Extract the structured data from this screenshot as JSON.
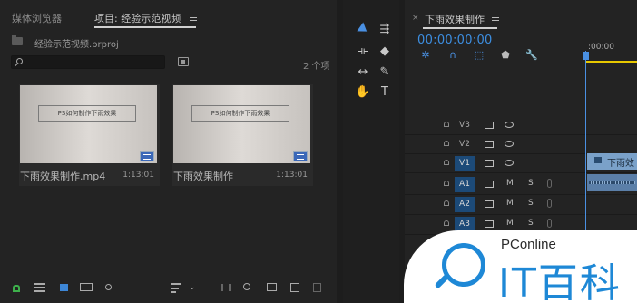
{
  "project_panel": {
    "tab_media_browser": "媒体浏览器",
    "tab_project": "项目: 经验示范视频",
    "project_file": "经验示范视频.prproj",
    "item_count": "2 个项",
    "clips": [
      {
        "thumb_text": "PS如何制作下雨效果",
        "name": "下雨效果制作.mp4",
        "duration": "1:13:01"
      },
      {
        "thumb_text": "PS如何制作下雨效果",
        "name": "下雨效果制作",
        "duration": "1:13:01"
      }
    ]
  },
  "tools": {
    "items": [
      "selection-tool",
      "track-select-tool",
      "ripple-edit-tool",
      "razor-tool",
      "slip-tool",
      "pen-tool",
      "hand-tool",
      "type-tool"
    ],
    "type_glyph": "T"
  },
  "sequence": {
    "title": "下雨效果制作",
    "close_glyph": "×",
    "timecode": "00:00:00:00",
    "ruler_label": ":00:00",
    "tracks": [
      {
        "name": "V3",
        "kind": "video",
        "active": false
      },
      {
        "name": "V2",
        "kind": "video",
        "active": false
      },
      {
        "name": "V1",
        "kind": "video",
        "active": true
      },
      {
        "name": "A1",
        "kind": "audio",
        "active": true
      },
      {
        "name": "A2",
        "kind": "audio",
        "active": true
      },
      {
        "name": "A3",
        "kind": "audio",
        "active": true
      }
    ],
    "audio_m": "M",
    "audio_s": "S",
    "video_clip_label": "下雨效"
  },
  "watermark": {
    "brand": "PConline",
    "name_cn": "IT百科"
  },
  "colors": {
    "accent": "#4a90e2",
    "track_active": "#1c4a78",
    "video_clip": "#7aa1c9",
    "lock_green": "#3db04b",
    "watermark_blue": "#1e88d6"
  }
}
